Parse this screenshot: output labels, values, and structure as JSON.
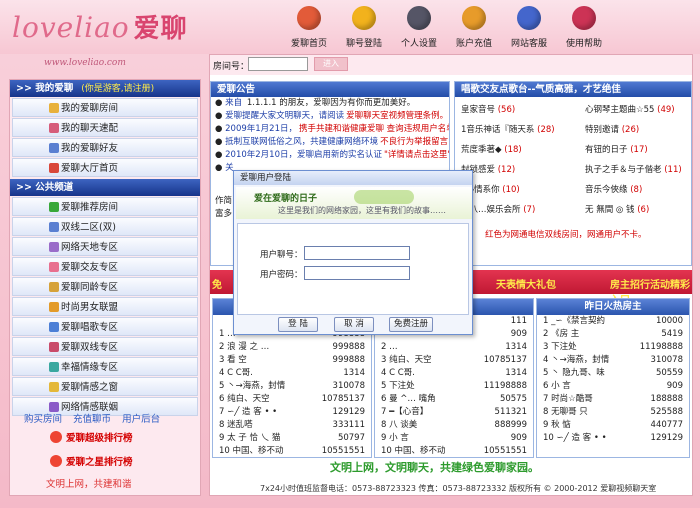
{
  "logo": {
    "text": "loveliao",
    "cn": "爱聊",
    "site": "www.loveliao.com"
  },
  "nav": [
    {
      "label": "爱聊首页",
      "icon": "home-icon",
      "color": "#e25b39"
    },
    {
      "label": "聊号登陆",
      "icon": "user-login-icon",
      "color": "#f2b21c"
    },
    {
      "label": "个人设置",
      "icon": "settings-icon",
      "color": "#556"
    },
    {
      "label": "账户充值",
      "icon": "money-bag-icon",
      "color": "#e79b2a"
    },
    {
      "label": "网站客服",
      "icon": "customer-service-icon",
      "color": "#4466cc"
    },
    {
      "label": "使用帮助",
      "icon": "help-icon",
      "color": "#cc3355"
    }
  ],
  "sidebar": {
    "group1": {
      "title": "我的爱聊",
      "sub": "(你是游客,请注册)"
    },
    "items1": [
      "我的爱聊房间",
      "我的聊天速配",
      "我的爱聊好友",
      "爱聊大厅首页"
    ],
    "group2": {
      "title": "公共频道"
    },
    "items2": [
      "爱聊推荐房间",
      "双线二区(双)",
      "网络天地专区",
      "爱聊交友专区",
      "爱聊同龄专区",
      "时尚男女联盟",
      "爱聊唱歌专区",
      "爱聊双线专区",
      "幸福情缘专区",
      "爱聊情感之窗",
      "网络情感联姻"
    ],
    "links": [
      "购买房间",
      "充值聊币",
      "用户后台"
    ],
    "rank1": "爱聊超级排行榜",
    "rank2": "爱聊之星排行榜",
    "slogan": "文明上网，共建和谐"
  },
  "roombar": {
    "label": "房间号：",
    "go": "进入"
  },
  "announce": {
    "title": "爱聊公告",
    "lines": [
      {
        "a": "来自",
        "b": " 1.1.1.1 的朋友，爱聊因为有你而更加美好。"
      },
      {
        "a": "爱聊提醒大家文明聊天，请阅读",
        "b": "爱聊聊天室视频管理条例。"
      },
      {
        "a": "2009年1月21日，",
        "b": "携手共建和谐健康爱聊 查询违规用户名单"
      },
      {
        "a": "抵制互联网低俗之风，共建健康网络环境",
        "b": "不良行为举报留言"
      },
      {
        "a": "2010年2月10日，爱聊启用新的实名认证",
        "b": "\"详情请点击这里\""
      },
      {
        "a": "关",
        "b": ""
      }
    ],
    "extra1": "作简",
    "extra2": "富多"
  },
  "songs": {
    "title": "唱歌交友点歌台--气质高雅，才艺绝佳",
    "items": [
      {
        "name": "皇家音号",
        "num": "(56)"
      },
      {
        "name": "心钢琴主题曲☆55",
        "num": "(49)"
      },
      {
        "name": "1音乐神话『随天系",
        "num": "(28)"
      },
      {
        "name": "特别邀请",
        "num": "(26)"
      },
      {
        "name": "荒度季著◆",
        "num": "(18)"
      },
      {
        "name": "有钮的日子",
        "num": "(17)"
      },
      {
        "name": "封锁感爱",
        "num": "(12)"
      },
      {
        "name": "执子之手＆与子偕老",
        "num": "(11)"
      },
      {
        "name": "◇◇情系你",
        "num": "(10)"
      },
      {
        "name": "音乐今俠缘",
        "num": "(8)"
      },
      {
        "name": "激八…娱乐会所",
        "num": "(7)"
      },
      {
        "name": "无 無間 ◎ 钱",
        "num": "(6)"
      }
    ],
    "notice": "红色为网通电信双线房间，网通用户不卡。"
  },
  "banner": {
    "t1": "免",
    "t2": "天表情大礼包",
    "t3": "房主招行活动精彩入口"
  },
  "columns": [
    {
      "title": "",
      "rows": [
        {
          "name": "",
          "v": ""
        },
        {
          "name": "1 …",
          "v": "998888"
        },
        {
          "name": "2 浪 漫 之 …",
          "v": "999888"
        },
        {
          "name": "3 看 空",
          "v": "999888"
        },
        {
          "name": "4 C C哥.",
          "v": "1314"
        },
        {
          "name": "5 丶→海燕，封情",
          "v": "310078"
        },
        {
          "name": "6 纯白、天空",
          "v": "10785137"
        },
        {
          "name": "7 ∽╱ 造 客 • •",
          "v": "129129"
        },
        {
          "name": "8 迷乱嗒",
          "v": "333111"
        },
        {
          "name": "9 太 子 恰 乀 猫",
          "v": "50797"
        },
        {
          "name": "10 中国、移不动",
          "v": "10551551"
        }
      ]
    },
    {
      "title": "人",
      "rows": [
        {
          "name": "",
          "v": "111"
        },
        {
          "name": "",
          "v": "909"
        },
        {
          "name": "2 …",
          "v": "1314"
        },
        {
          "name": "3 纯白、天空",
          "v": "10785137"
        },
        {
          "name": "4 C C哥.",
          "v": "1314"
        },
        {
          "name": "5 下注处",
          "v": "11198888"
        },
        {
          "name": "6 曼 ^… 嘴角",
          "v": "50575"
        },
        {
          "name": "7 ━【心音】",
          "v": "511321"
        },
        {
          "name": "8 八 谈美",
          "v": "888999"
        },
        {
          "name": "9 小 言",
          "v": "909"
        },
        {
          "name": "10 中国、移不动",
          "v": "10551551"
        }
      ]
    },
    {
      "title": "昨日火热房主",
      "rows": [
        {
          "name": "1 _∽《禁言契約",
          "v": "10000"
        },
        {
          "name": "2 《房 主",
          "v": "5419"
        },
        {
          "name": "3 下注处",
          "v": "11198888"
        },
        {
          "name": "4 丶→海燕，封情",
          "v": "310078"
        },
        {
          "name": "5 丶 隐九哥、味",
          "v": "50559"
        },
        {
          "name": "6 小 言",
          "v": "909"
        },
        {
          "name": "7 时尚☆酷哥",
          "v": "188888"
        },
        {
          "name": "8 无聊哥 只",
          "v": "525588"
        },
        {
          "name": "9 秋 惦",
          "v": "440777"
        },
        {
          "name": "10 ∽╱ 造 客 • •",
          "v": "129129"
        }
      ]
    }
  ],
  "bottom_slogan": "文明上网，文明聊天，共建绿色爱聊家园。",
  "footer": "7x24小时值班监督电话：0573-88723323    传真：0573-88723332  版权所有 © 2000-2012  爱聊视频聊天室",
  "dialog": {
    "title": "爱聊用户登陆",
    "headline": "爱在爱聊的日子",
    "subline": "这里是我们的网络家园，这里有我们的故事……",
    "user_label": "用户聊号：",
    "pass_label": "用户密码：",
    "login": "登 陆",
    "cancel": "取 消",
    "register": "免费注册"
  }
}
